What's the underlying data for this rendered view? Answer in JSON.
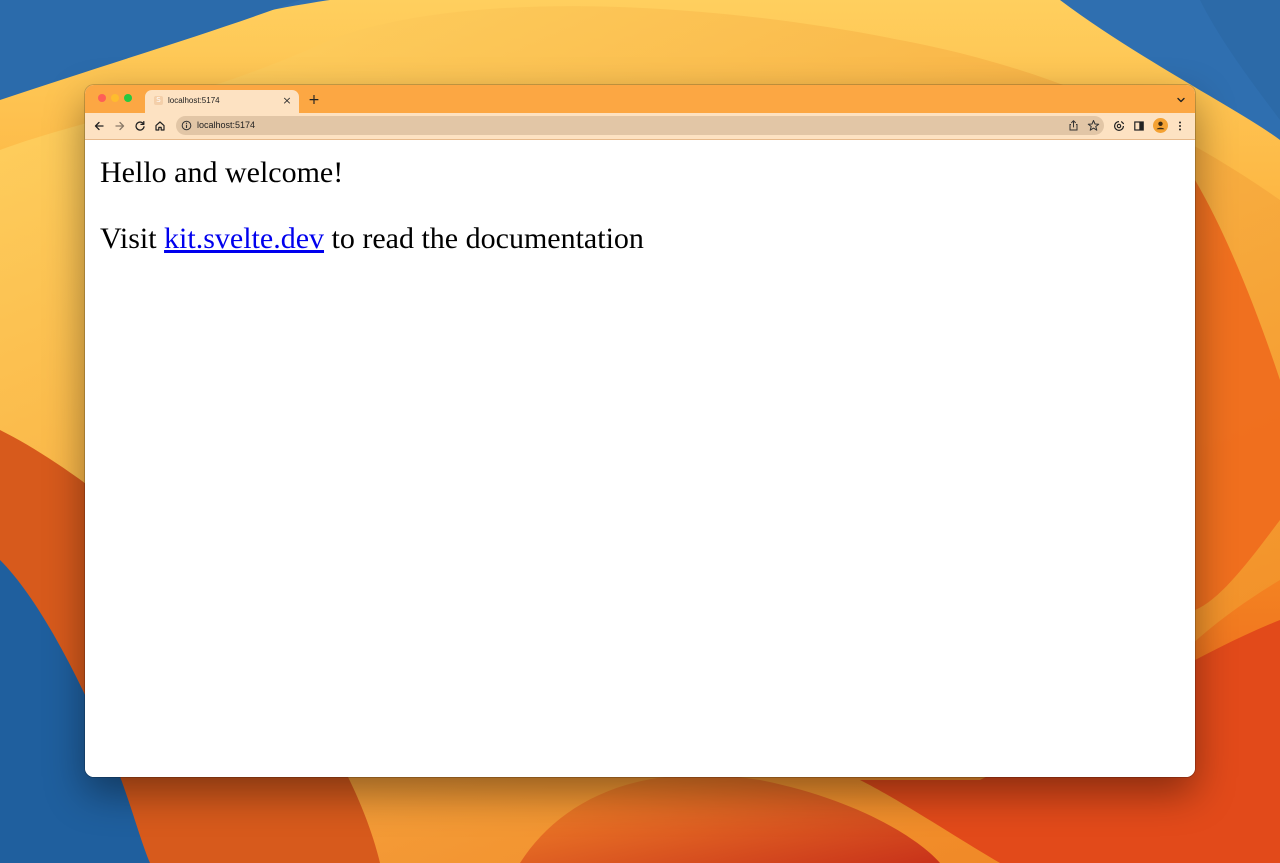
{
  "window": {
    "tab": {
      "title": "localhost:5174",
      "favicon_glyph": "S",
      "close_glyph": "×"
    },
    "new_tab_glyph": "+"
  },
  "toolbar": {
    "url": "localhost:5174",
    "avatar_color": "#f4a233"
  },
  "page": {
    "heading": "Hello and welcome!",
    "paragraph_prefix": "Visit ",
    "link_text": "kit.svelte.dev",
    "paragraph_suffix": " to read the documentation",
    "link_color": "#0000ee"
  },
  "theme": {
    "tabstrip_color": "#fca743",
    "toolbar_color": "#fde2c2",
    "omnibox_color": "#e2c6a6"
  }
}
